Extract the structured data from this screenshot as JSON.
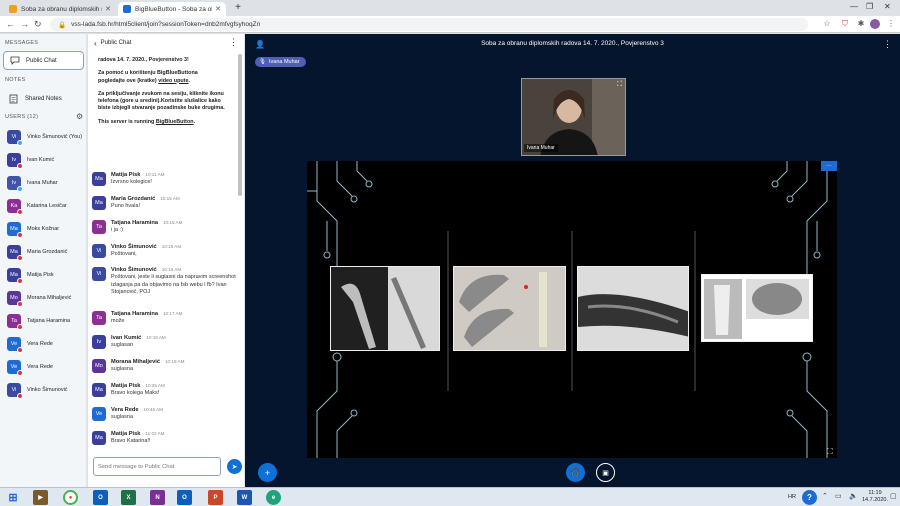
{
  "browser": {
    "tabs": [
      {
        "title": "Soba za obranu diplomskih rada",
        "active": false
      },
      {
        "title": "BigBlueButton - Soba za ob",
        "active": true
      }
    ],
    "url": "vss-lada.fsb.hr/html5client/join?sessionToken=dnb2mfvgfsyhoqZn"
  },
  "sidebar": {
    "messages_heading": "MESSAGES",
    "public_chat": "Public Chat",
    "notes_heading": "NOTES",
    "shared_notes": "Shared Notes",
    "users_heading": "USERS (12)",
    "users": [
      {
        "initials": "Vi",
        "name": "Vinko Šimunović (You)",
        "color": "#3a4aa0",
        "status": "#3bb0e0"
      },
      {
        "initials": "Iv",
        "name": "Ivan Kumić",
        "color": "#3b3f9c",
        "status": "#e0313c"
      },
      {
        "initials": "Iv",
        "name": "Ivana Muhar",
        "color": "#4054a8",
        "status": "#3bb0e0"
      },
      {
        "initials": "Ka",
        "name": "Katarina Lesičar",
        "color": "#8b2f93",
        "status": "#e0313c"
      },
      {
        "initials": "Ma",
        "name": "Moks Kožnar",
        "color": "#1e6bd6",
        "status": "#e0313c"
      },
      {
        "initials": "Ma",
        "name": "Maria Grozdanić",
        "color": "#3b3f9c",
        "status": "#e0313c"
      },
      {
        "initials": "Ma",
        "name": "Matija Pisk",
        "color": "#3b3f9c",
        "status": "#e0313c"
      },
      {
        "initials": "Mo",
        "name": "Morana Mihaljević",
        "color": "#5b3598",
        "status": "#e0313c"
      },
      {
        "initials": "Ta",
        "name": "Tatjana Haramina",
        "color": "#8b2f93",
        "status": "#e0313c"
      },
      {
        "initials": "Ve",
        "name": "Vera Rede",
        "color": "#1e6bd6",
        "status": "#e0313c"
      },
      {
        "initials": "Ve",
        "name": "Vera Rede",
        "color": "#1e6bd6",
        "status": "#e0313c"
      },
      {
        "initials": "Vi",
        "name": "Vinko Šimunović",
        "color": "#3a4aa0",
        "status": "#e0313c"
      }
    ]
  },
  "chat": {
    "header": "Public Chat",
    "welcome": {
      "line1": "radova 14. 7. 2020., Povjerenstvo 3!",
      "line2a": "Za pomoć u korištenju BigBlueButtona pogledajte ove (kratke) ",
      "line2link": "video upute",
      "line2b": ".",
      "line3": "Za priključivanje zvukom na sesiju, kliknite ikonu telefona (gore u sredini).Koristite slušalice kako biste izbjegli stvaranje pozadinske buke drugima.",
      "line4a": "This server is running ",
      "line4link": "BigBlueButton",
      "line4b": "."
    },
    "messages": [
      {
        "initials": "Ma",
        "color": "#3b3f9c",
        "name": "Matija Pisk",
        "time": "10:11 AM",
        "text": "Izvrsno kolegice!"
      },
      {
        "initials": "Ma",
        "color": "#3b3f9c",
        "name": "Maria Grozdanić",
        "time": "10:15 AM",
        "text": "Puno hvala!"
      },
      {
        "initials": "Ta",
        "color": "#8b2f93",
        "name": "Tatjana Haramina",
        "time": "10:15 AM",
        "text": "i ja :)"
      },
      {
        "initials": "Vi",
        "color": "#3a4aa0",
        "name": "Vinko Šimunović",
        "time": "10:16 AM",
        "text": "Poštovani,"
      },
      {
        "initials": "Vi",
        "color": "#3a4aa0",
        "name": "Vinko Šimunović",
        "time": "10:16 AM",
        "text": "Poštovani, jeste li suglasni da napravim screenshot izlaganja pa da objavimo na fsb webu i fb? Ivan Stojanović, POJ"
      },
      {
        "initials": "Ta",
        "color": "#8b2f93",
        "name": "Tatjana Haramina",
        "time": "10:17 AM",
        "text": "može"
      },
      {
        "initials": "Iv",
        "color": "#3b3f9c",
        "name": "Ivan Kumić",
        "time": "10:18 AM",
        "text": "suglasan"
      },
      {
        "initials": "Mo",
        "color": "#5b3598",
        "name": "Morana Mihaljević",
        "time": "10:18 AM",
        "text": "suglasna"
      },
      {
        "initials": "Ma",
        "color": "#3b3f9c",
        "name": "Matija Pisk",
        "time": "10:35 AM",
        "text": "Bravo kolega Maks!"
      },
      {
        "initials": "Ve",
        "color": "#1e6bd6",
        "name": "Vera Rede",
        "time": "10:46 AM",
        "text": "suglasna"
      },
      {
        "initials": "Ma",
        "color": "#3b3f9c",
        "name": "Matija Pisk",
        "time": "11:02 AM",
        "text": "Bravo Katarina!!"
      }
    ],
    "input_placeholder": "Send message to Public Chat"
  },
  "main": {
    "room_title": "Soba za obranu diplomskih radova 14. 7. 2020., Povjerenstvo 3",
    "presenter": "Ivana Muhar",
    "webcam_name": "Ivana Muhar"
  },
  "taskbar": {
    "lang": "HR",
    "time": "11:19",
    "date": "14.7.2020."
  }
}
